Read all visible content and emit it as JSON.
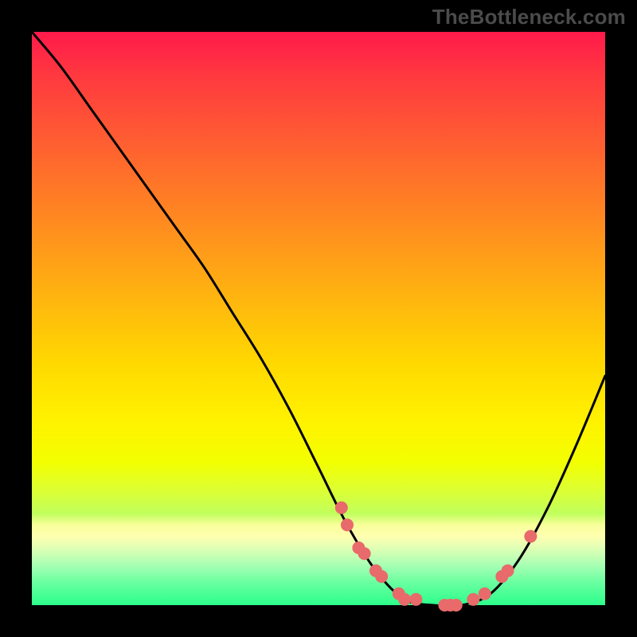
{
  "attribution": "TheBottleneck.com",
  "chart_data": {
    "type": "line",
    "title": "",
    "xlabel": "",
    "ylabel": "",
    "xlim": [
      0,
      100
    ],
    "ylim": [
      0,
      100
    ],
    "series": [
      {
        "name": "bottleneck-curve",
        "x": [
          0,
          5,
          10,
          15,
          20,
          25,
          30,
          35,
          40,
          45,
          50,
          55,
          60,
          65,
          70,
          75,
          80,
          85,
          90,
          95,
          100
        ],
        "values": [
          100,
          94,
          87,
          80,
          73,
          66,
          59,
          51,
          43,
          34,
          24,
          14,
          6,
          1,
          0,
          0,
          2,
          8,
          17,
          28,
          40
        ]
      }
    ],
    "markers": {
      "name": "highlighted-points",
      "color": "#e86a6a",
      "points": [
        {
          "x": 54,
          "y": 17
        },
        {
          "x": 55,
          "y": 14
        },
        {
          "x": 57,
          "y": 10
        },
        {
          "x": 58,
          "y": 9
        },
        {
          "x": 60,
          "y": 6
        },
        {
          "x": 61,
          "y": 5
        },
        {
          "x": 64,
          "y": 2
        },
        {
          "x": 65,
          "y": 1
        },
        {
          "x": 67,
          "y": 1
        },
        {
          "x": 72,
          "y": 0
        },
        {
          "x": 73,
          "y": 0
        },
        {
          "x": 74,
          "y": 0
        },
        {
          "x": 77,
          "y": 1
        },
        {
          "x": 79,
          "y": 2
        },
        {
          "x": 82,
          "y": 5
        },
        {
          "x": 83,
          "y": 6
        },
        {
          "x": 87,
          "y": 12
        }
      ]
    },
    "background": {
      "gradient_top_color": "#ff1a4b",
      "gradient_mid_color": "#ffd900",
      "gradient_bottom_color": "#2cff8c"
    }
  }
}
